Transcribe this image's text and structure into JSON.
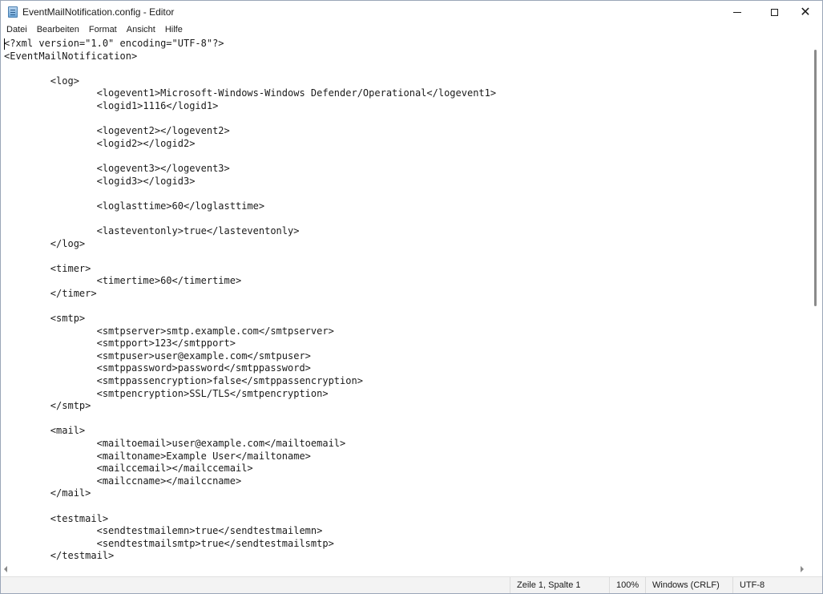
{
  "window": {
    "title": "EventMailNotification.config - Editor",
    "controls": {
      "minimize": "—",
      "maximize": "☐",
      "close": "✕"
    }
  },
  "menu": [
    "Datei",
    "Bearbeiten",
    "Format",
    "Ansicht",
    "Hilfe"
  ],
  "editor": {
    "lines": [
      "<?xml version=\"1.0\" encoding=\"UTF-8\"?>",
      "<EventMailNotification>",
      "",
      "\t<log>",
      "\t\t<logevent1>Microsoft-Windows-Windows Defender/Operational</logevent1>",
      "\t\t<logid1>1116</logid1>",
      "",
      "\t\t<logevent2></logevent2>",
      "\t\t<logid2></logid2>",
      "",
      "\t\t<logevent3></logevent3>",
      "\t\t<logid3></logid3>",
      "",
      "\t\t<loglasttime>60</loglasttime>",
      "",
      "\t\t<lasteventonly>true</lasteventonly>",
      "\t</log>",
      "",
      "\t<timer>",
      "\t\t<timertime>60</timertime>",
      "\t</timer>",
      "",
      "\t<smtp>",
      "\t\t<smtpserver>smtp.example.com</smtpserver>",
      "\t\t<smtpport>123</smtpport>",
      "\t\t<smtpuser>user@example.com</smtpuser>",
      "\t\t<smtppassword>password</smtppassword>",
      "\t\t<smtppassencryption>false</smtppassencryption>",
      "\t\t<smtpencryption>SSL/TLS</smtpencryption>",
      "\t</smtp>",
      "",
      "\t<mail>",
      "\t\t<mailtoemail>user@example.com</mailtoemail>",
      "\t\t<mailtoname>Example User</mailtoname>",
      "\t\t<mailccemail></mailccemail>",
      "\t\t<mailccname></mailccname>",
      "\t</mail>",
      "",
      "\t<testmail>",
      "\t\t<sendtestmailemn>true</sendtestmailemn>",
      "\t\t<sendtestmailsmtp>true</sendtestmailsmtp>",
      "\t</testmail>"
    ]
  },
  "status": {
    "position": "Zeile 1, Spalte 1",
    "zoom": "100%",
    "line_ending": "Windows (CRLF)",
    "encoding": "UTF-8"
  }
}
